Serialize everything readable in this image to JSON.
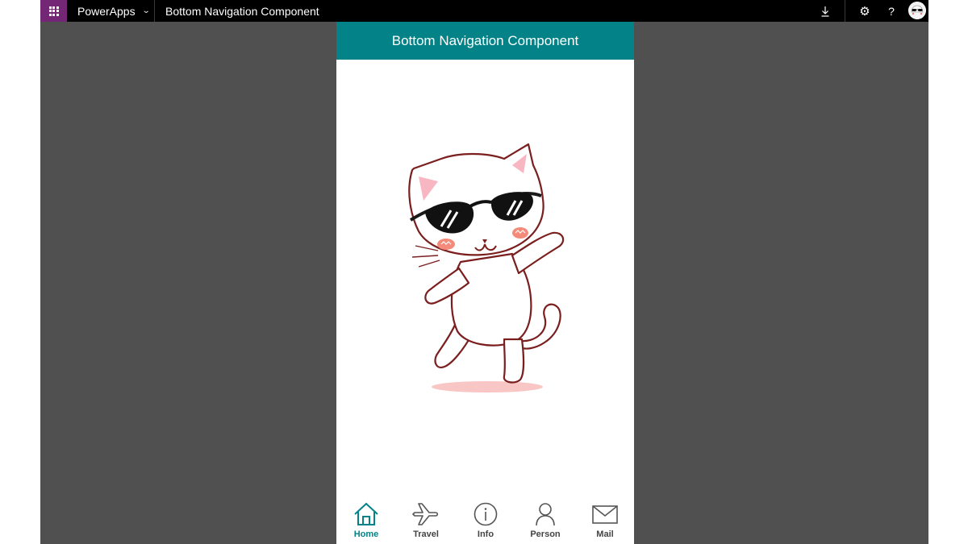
{
  "topbar": {
    "app_name": "PowerApps",
    "doc_title": "Bottom Navigation Component",
    "icons": [
      "app-launcher-icon",
      "chevron-down-icon",
      "download-icon",
      "settings-gear-icon",
      "help-icon",
      "user-avatar"
    ]
  },
  "app": {
    "header_title": "Bottom Navigation Component",
    "header_color": "#038387",
    "hero_image": "dancing-cat-sunglasses-illustration",
    "nav": {
      "active_color": "#038387",
      "inactive_color": "#444444",
      "items": [
        {
          "label": "Home",
          "icon": "home-icon",
          "active": true
        },
        {
          "label": "Travel",
          "icon": "airplane-icon",
          "active": false
        },
        {
          "label": "Info",
          "icon": "info-icon",
          "active": false
        },
        {
          "label": "Person",
          "icon": "person-icon",
          "active": false
        },
        {
          "label": "Mail",
          "icon": "mail-icon",
          "active": false
        }
      ]
    }
  },
  "colors": {
    "suite_purple": "#742774",
    "topbar_bg": "#000000",
    "canvas_bg": "#505050"
  }
}
